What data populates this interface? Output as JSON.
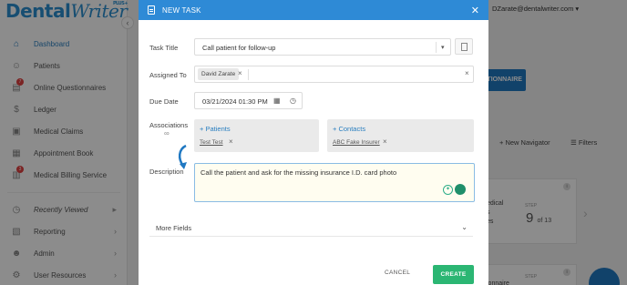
{
  "app": {
    "logo_main": "Dental",
    "logo_script": "Writer",
    "logo_plus": "PLUS+",
    "user_email": "DZarate@dentalwriter.com"
  },
  "sidebar": {
    "items": [
      {
        "label": "Dashboard",
        "icon": "home-icon"
      },
      {
        "label": "Patients",
        "icon": "patients-icon"
      },
      {
        "label": "Online Questionnaires",
        "icon": "questionnaire-icon",
        "badge": "7"
      },
      {
        "label": "Ledger",
        "icon": "dollar-icon"
      },
      {
        "label": "Medical Claims",
        "icon": "claims-icon"
      },
      {
        "label": "Appointment Book",
        "icon": "calendar-icon"
      },
      {
        "label": "Medical Billing Service",
        "icon": "billing-icon",
        "badge": "3"
      },
      {
        "label": "Recently Viewed",
        "icon": "clock-icon"
      },
      {
        "label": "Reporting",
        "icon": "reporting-icon"
      },
      {
        "label": "Admin",
        "icon": "admin-icon"
      },
      {
        "label": "User Resources",
        "icon": "resources-icon"
      }
    ]
  },
  "background": {
    "questionnaire_button": "ESTIONNAIRE",
    "new_navigator": "New Navigator",
    "filters": "Filters",
    "card1_title_a": "edical",
    "card1_title_b": "s",
    "card1_title_c": "es",
    "card1_step_label": "STEP",
    "card1_step_value": "9",
    "card1_step_of": "of 13",
    "card2_title": "t",
    "card2_title_b": "ionnaire",
    "card2_step_label": "STEP"
  },
  "modal": {
    "title": "NEW TASK",
    "task_title_label": "Task Title",
    "task_title_value": "Call patient for follow-up",
    "assigned_to_label": "Assigned To",
    "assigned_to_chip": "David Zarate",
    "due_date_label": "Due Date",
    "due_date_value": "03/21/2024 01:30 PM",
    "associations_label": "Associations",
    "patients_add": "Patients",
    "patients_value": "Test Test",
    "contacts_add": "Contacts",
    "contacts_value": "ABC Fake Insurer",
    "description_label": "Description",
    "description_value": "Call the patient and ask for the missing insurance I.D. card photo",
    "more_fields": "More Fields",
    "cancel_label": "CANCEL",
    "create_label": "CREATE"
  },
  "colors": {
    "header": "#2e8ad6",
    "create": "#2bb673",
    "accent": "#2a7fc0"
  }
}
